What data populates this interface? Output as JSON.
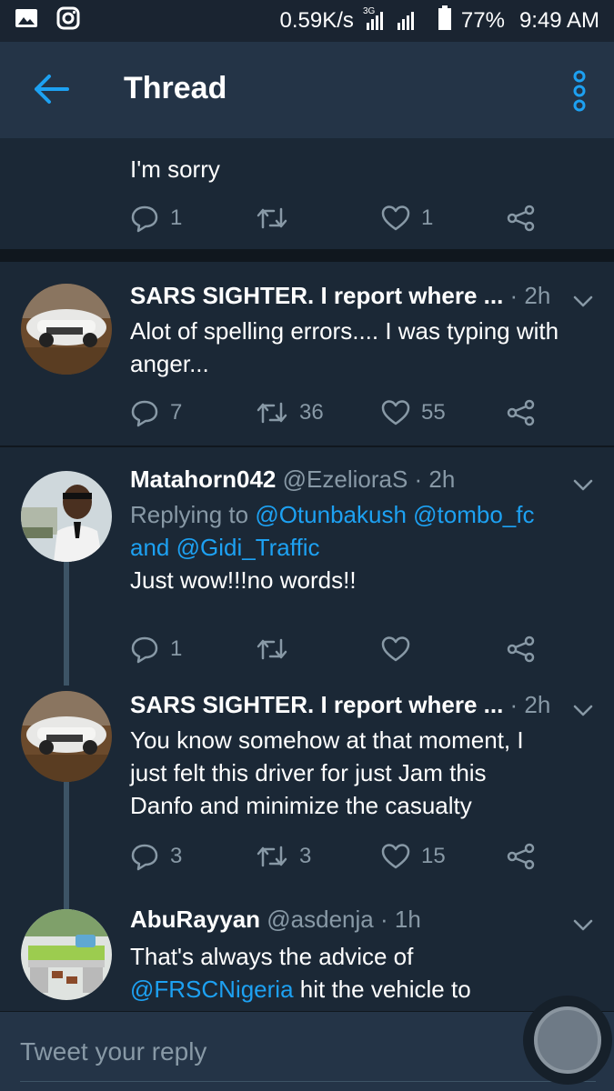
{
  "status_bar": {
    "speed": "0.59K/s",
    "network": "3G",
    "battery": "77%",
    "time": "9:49 AM",
    "icons": [
      "image-icon",
      "instagram-icon",
      "signal-icon",
      "battery-icon"
    ]
  },
  "app_bar": {
    "title": "Thread",
    "back_icon": "arrow-left-icon",
    "menu_icon": "overflow-menu-icon"
  },
  "colors": {
    "accent": "#1da1f2",
    "background": "#1b2836",
    "appbar": "#243447",
    "muted": "#8899a6",
    "divider": "#10171e"
  },
  "tweets": [
    {
      "text": "I'm sorry",
      "replies": "1",
      "retweets": "",
      "likes": "1"
    },
    {
      "name": "SARS SIGHTER. I report where ...",
      "handle": "",
      "time": "· 2h",
      "text": "Alot of spelling errors.... I was typing with anger...",
      "replies": "7",
      "retweets": "36",
      "likes": "55"
    },
    {
      "name": "Matahorn042",
      "handle": "@EzelioraS",
      "time": "· 2h",
      "replying_prefix": "Replying to",
      "replying_user1": "@Otunbakush",
      "replying_user2": "@tombo_fc",
      "replying_and": "and",
      "replying_user3": "@Gidi_Traffic",
      "text": "Just wow!!!no words!!",
      "replies": "1",
      "retweets": "",
      "likes": ""
    },
    {
      "name": "SARS SIGHTER. I report where ...",
      "handle": "",
      "time": "· 2h",
      "text_line1": "You know somehow at that moment, I",
      "text_line2": "just felt this driver for just Jam this",
      "text_line3": "Danfo and minimize the casualty",
      "replies": "3",
      "retweets": "3",
      "likes": "15"
    },
    {
      "name": "AbuRayyan",
      "handle": "@asdenja",
      "time": "· 1h",
      "text_line1": "That's always the advice of",
      "text_mention": "@FRSCNigeria",
      "text_line2_rest": " hit the vehicle to"
    }
  ],
  "compose": {
    "placeholder": "Tweet your reply"
  }
}
